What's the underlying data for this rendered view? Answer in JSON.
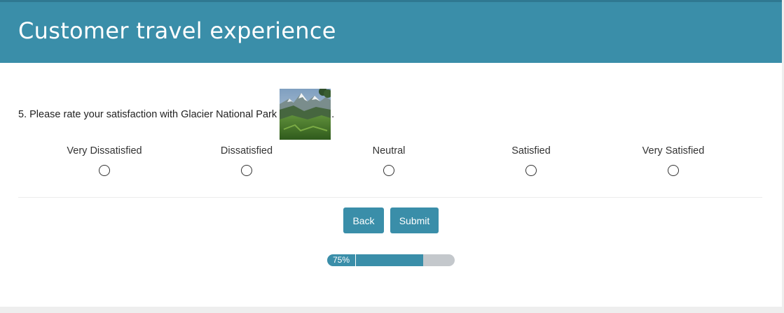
{
  "header": {
    "title": "Customer travel experience"
  },
  "question": {
    "text": "5. Please rate your satisfaction with Glacier National Park",
    "image_icon": "mountain-landscape-photo",
    "trailing": "."
  },
  "options": [
    {
      "label": "Very Dissatisfied",
      "selected": false
    },
    {
      "label": "Dissatisfied",
      "selected": false
    },
    {
      "label": "Neutral",
      "selected": false
    },
    {
      "label": "Satisfied",
      "selected": false
    },
    {
      "label": "Very Satisfied",
      "selected": false
    }
  ],
  "buttons": {
    "back_label": "Back",
    "submit_label": "Submit"
  },
  "progress": {
    "label": "75%",
    "value": 0.75
  },
  "colors": {
    "accent": "#3a8ea9",
    "track": "#c4c8cc"
  }
}
